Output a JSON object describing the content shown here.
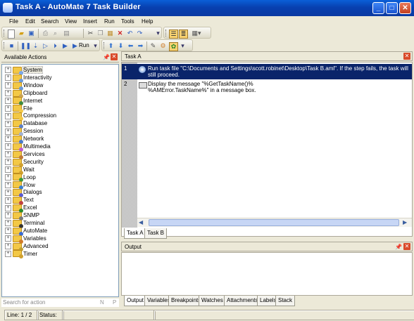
{
  "window": {
    "title": "Task A - AutoMate 7 Task Builder"
  },
  "menu": [
    "File",
    "Edit",
    "Search",
    "View",
    "Insert",
    "Run",
    "Tools",
    "Help"
  ],
  "toolbar": {
    "run_label": "Run"
  },
  "actions_panel": {
    "title": "Available Actions",
    "items": [
      {
        "label": "System",
        "icon": "gear"
      },
      {
        "label": "Interactivity",
        "icon": "window"
      },
      {
        "label": "Window",
        "icon": "window"
      },
      {
        "label": "Clipboard",
        "icon": "clipboard"
      },
      {
        "label": "Internet",
        "icon": "globe"
      },
      {
        "label": "File",
        "icon": "folder"
      },
      {
        "label": "Compression",
        "icon": "folder"
      },
      {
        "label": "Database",
        "icon": "database"
      },
      {
        "label": "Session",
        "icon": "session"
      },
      {
        "label": "Network",
        "icon": "network"
      },
      {
        "label": "Multimedia",
        "icon": "media"
      },
      {
        "label": "Services",
        "icon": "services"
      },
      {
        "label": "Security",
        "icon": "lock"
      },
      {
        "label": "Wait",
        "icon": "clock"
      },
      {
        "label": "Loop",
        "icon": "loop"
      },
      {
        "label": "Flow",
        "icon": "flow"
      },
      {
        "label": "Dialogs",
        "icon": "dialog"
      },
      {
        "label": "Text",
        "icon": "text"
      },
      {
        "label": "Excel",
        "icon": "excel"
      },
      {
        "label": "SNMP",
        "icon": "snmp"
      },
      {
        "label": "Terminal",
        "icon": "terminal"
      },
      {
        "label": "AutoMate",
        "icon": "automate"
      },
      {
        "label": "Variables",
        "icon": "variables"
      },
      {
        "label": "Advanced",
        "icon": "advanced"
      },
      {
        "label": "Timer",
        "icon": "timer"
      }
    ],
    "search_placeholder": "Search for action",
    "search_btn_n": "N",
    "search_btn_p": "P"
  },
  "task_panel": {
    "title": "Task A",
    "steps": [
      {
        "num": "1",
        "text": "Run task file \"C:\\Documents and Settings\\scott.robinet\\Desktop\\Task B.aml\".  If the step fails, the task will still proceed."
      },
      {
        "num": "2",
        "text": "Display the message \"%GetTaskName()%\n%AMError.TaskName%\" in a message box."
      }
    ],
    "tabs": [
      "Task A",
      "Task B"
    ]
  },
  "output_panel": {
    "title": "Output",
    "tabs": [
      "Output",
      "Variables",
      "Breakpoints",
      "Watches",
      "Attachments",
      "Labels",
      "Stack"
    ]
  },
  "status": {
    "line": "Line: 1 / 2",
    "status": "Status:"
  },
  "colors": {
    "selection": "#0a246a",
    "titlebar": "#0a5fd8"
  }
}
